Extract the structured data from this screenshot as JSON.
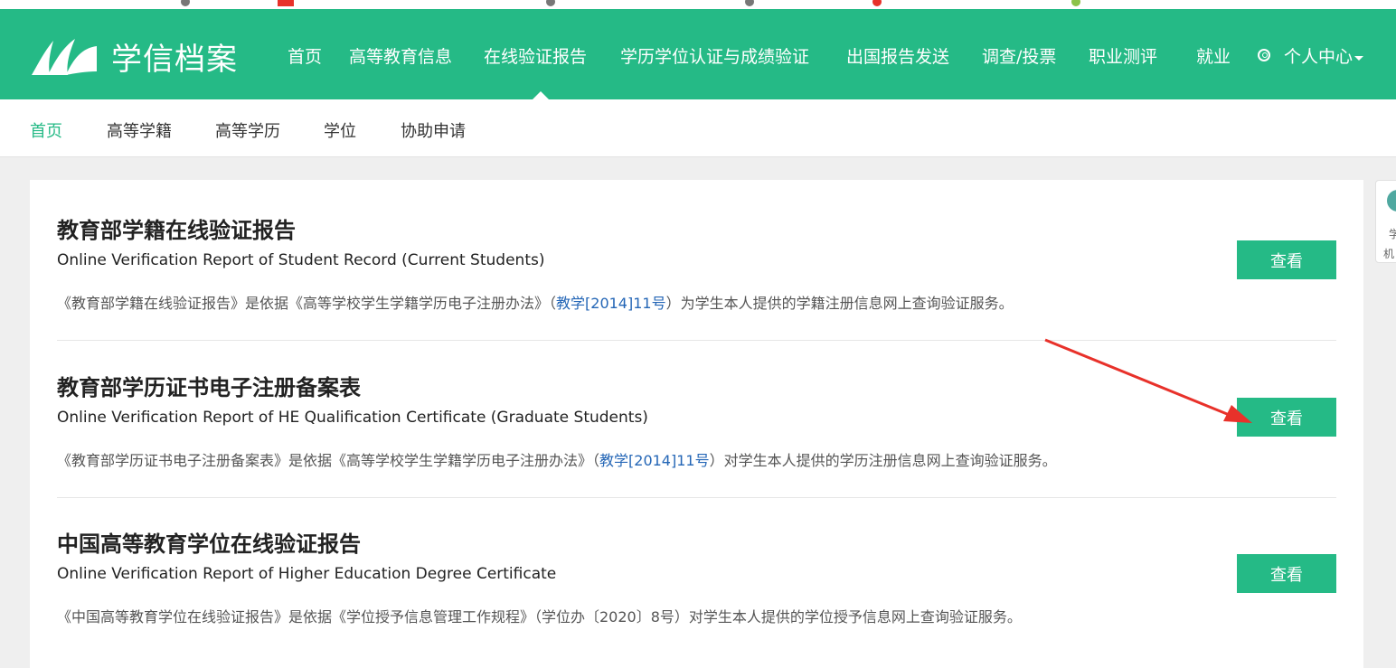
{
  "brand": {
    "logo_text": "学信档案",
    "accent_color": "#25ba86"
  },
  "topnav": {
    "items": [
      {
        "label": "首页"
      },
      {
        "label": "高等教育信息"
      },
      {
        "label": "在线验证报告"
      },
      {
        "label": "学历学位认证与成绩验证"
      },
      {
        "label": "出国报告发送"
      },
      {
        "label": "调查/投票"
      },
      {
        "label": "职业测评"
      },
      {
        "label": "就业"
      }
    ],
    "user_center": "个人中心"
  },
  "subnav": {
    "items": [
      {
        "label": "首页"
      },
      {
        "label": "高等学籍"
      },
      {
        "label": "高等学历"
      },
      {
        "label": "学位"
      },
      {
        "label": "协助申请"
      }
    ]
  },
  "entries": [
    {
      "title": "教育部学籍在线验证报告",
      "subtitle": "Online Verification Report of Student Record (Current Students)",
      "desc_before": "《教育部学籍在线验证报告》是依据《高等学校学生学籍学历电子注册办法》（",
      "desc_link": "教学[2014]11号",
      "desc_after": "）为学生本人提供的学籍注册信息网上查询验证服务。",
      "button": "查看"
    },
    {
      "title": "教育部学历证书电子注册备案表",
      "subtitle": "Online Verification Report of HE Qualification Certificate (Graduate Students)",
      "desc_before": "《教育部学历证书电子注册备案表》是依据《高等学校学生学籍学历电子注册办法》（",
      "desc_link": "教学[2014]11号",
      "desc_after": "）对学生本人提供的学历注册信息网上查询验证服务。",
      "button": "查看"
    },
    {
      "title": "中国高等教育学位在线验证报告",
      "subtitle": "Online Verification Report of Higher Education Degree Certificate",
      "desc_before": "《中国高等教育学位在线验证报告》是依据《学位授予信息管理工作规程》（学位办〔2020〕8号）对学生本人提供的学位授予信息网上查询验证服务。",
      "desc_link": "",
      "desc_after": "",
      "button": "查看"
    }
  ],
  "side_widget": {
    "line1": "学",
    "line2": "机"
  },
  "annotation_color": "#e8312a"
}
